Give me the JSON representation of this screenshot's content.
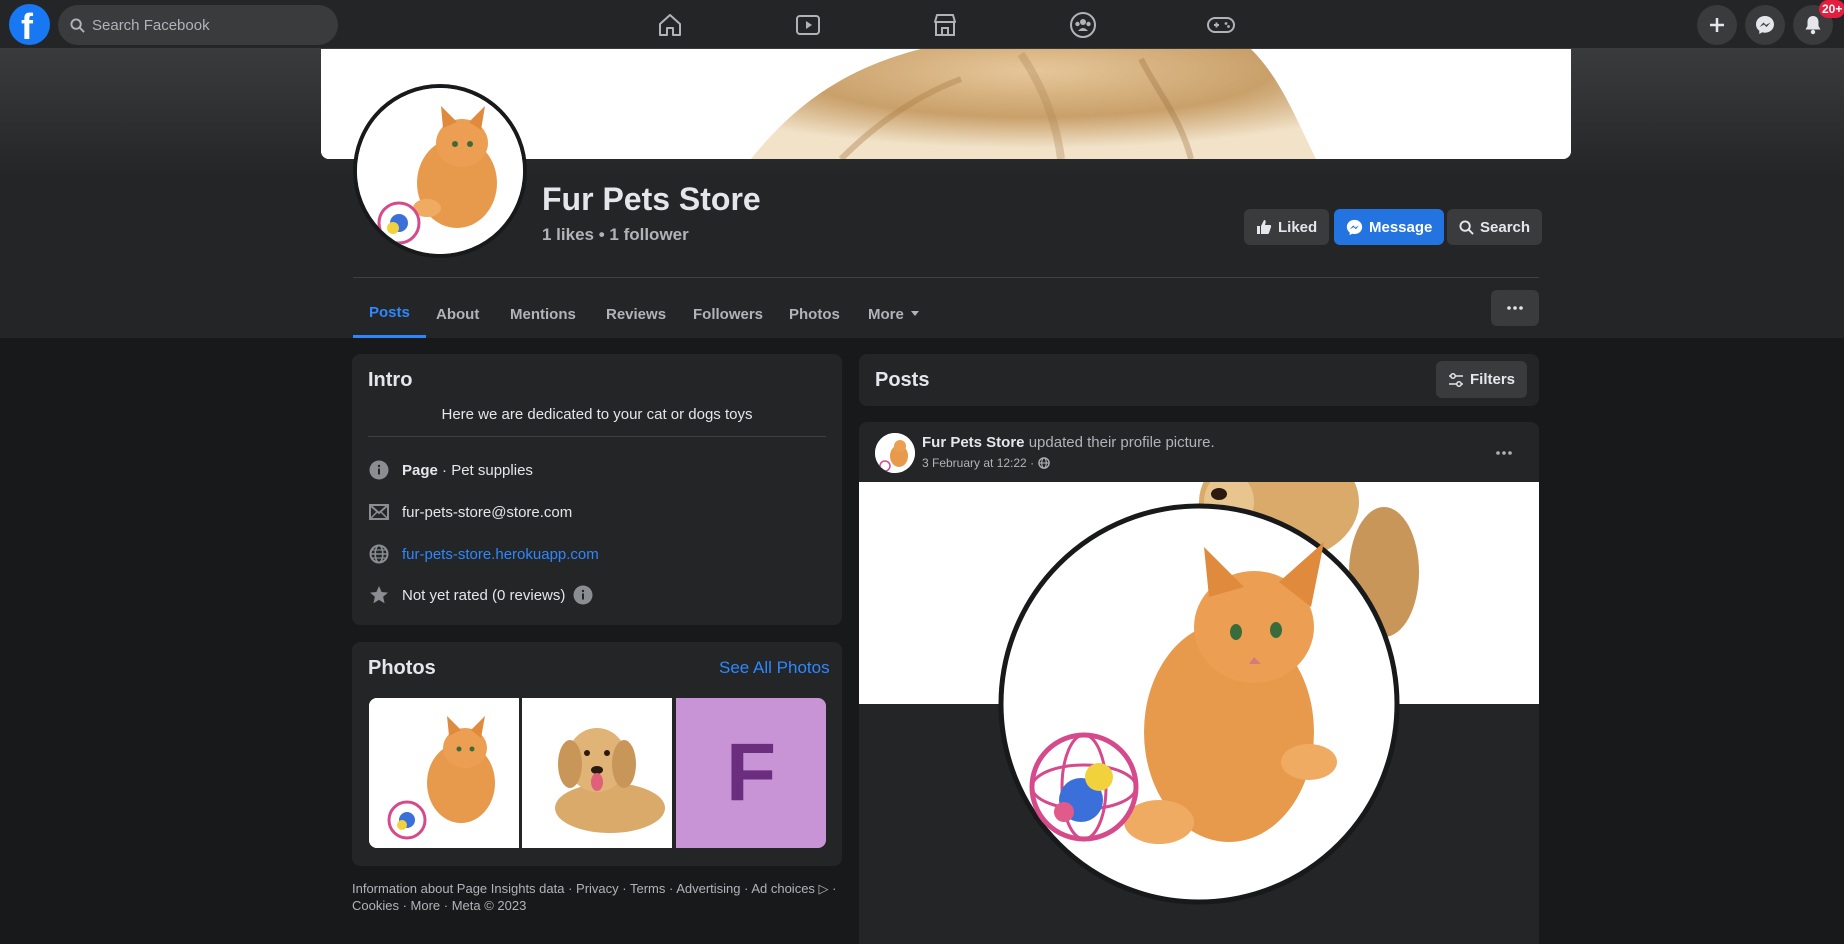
{
  "nav": {
    "logo": "f",
    "search_placeholder": "Search Facebook",
    "center_icons": [
      "home-icon",
      "watch-icon",
      "marketplace-icon",
      "groups-icon",
      "gaming-icon"
    ],
    "right_icons": [
      "plus-icon",
      "messenger-icon",
      "bell-icon"
    ],
    "notification_count": "20+"
  },
  "page": {
    "name": "Fur Pets Store",
    "stats": "1 likes • 1 follower",
    "liked_label": "Liked",
    "message_label": "Message",
    "search_label": "Search"
  },
  "tabs": {
    "posts": "Posts",
    "about": "About",
    "mentions": "Mentions",
    "reviews": "Reviews",
    "followers": "Followers",
    "photos": "Photos",
    "more": "More"
  },
  "intro": {
    "title": "Intro",
    "bio": "Here we are dedicated to your cat or dogs toys",
    "category_bold": "Page",
    "category_rest": " · Pet supplies",
    "email": "fur-pets-store@store.com",
    "website": "fur-pets-store.herokuapp.com",
    "rating": "Not yet rated (0 reviews)"
  },
  "photos": {
    "title": "Photos",
    "see_all": "See All Photos",
    "third_letter": "F"
  },
  "footer": {
    "line1": "Information about Page Insights data · Privacy · Terms · Advertising · Ad choices ▷ ·",
    "line2": "Cookies · More · Meta © 2023"
  },
  "feed": {
    "title": "Posts",
    "filters_label": "Filters",
    "post": {
      "author": "Fur Pets Store",
      "action": " updated their profile picture.",
      "timestamp": "3 February at 12:22 ·"
    }
  },
  "colors": {
    "accent": "#2d88ff",
    "button_blue": "#2374e1",
    "card_bg": "#242526",
    "page_bg": "#18191a",
    "badge": "#e41e3f",
    "photo_tile": "#c994d6",
    "photo_letter": "#6b2d7e"
  }
}
